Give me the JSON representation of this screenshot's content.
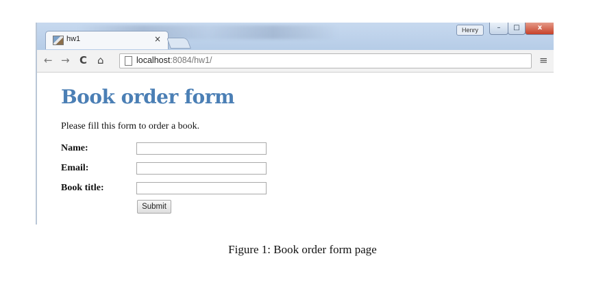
{
  "browser": {
    "tab_title": "hw1",
    "tab_close": "×",
    "user_badge": "Henry",
    "window_min": "–",
    "window_max": "□",
    "window_close": "x",
    "back": "←",
    "forward": "→",
    "reload": "C",
    "home": "⌂",
    "url_host": "localhost",
    "url_path": ":8084/hw1/",
    "menu": "≡"
  },
  "page": {
    "heading": "Book order form",
    "intro": "Please fill this form to order a book.",
    "fields": [
      {
        "label": "Name:",
        "value": ""
      },
      {
        "label": "Email:",
        "value": ""
      },
      {
        "label": "Book title:",
        "value": ""
      }
    ],
    "submit_label": "Submit"
  },
  "caption": "Figure 1: Book order form page",
  "colors": {
    "heading": "#4b7fb5",
    "close_button": "#c7422a"
  }
}
